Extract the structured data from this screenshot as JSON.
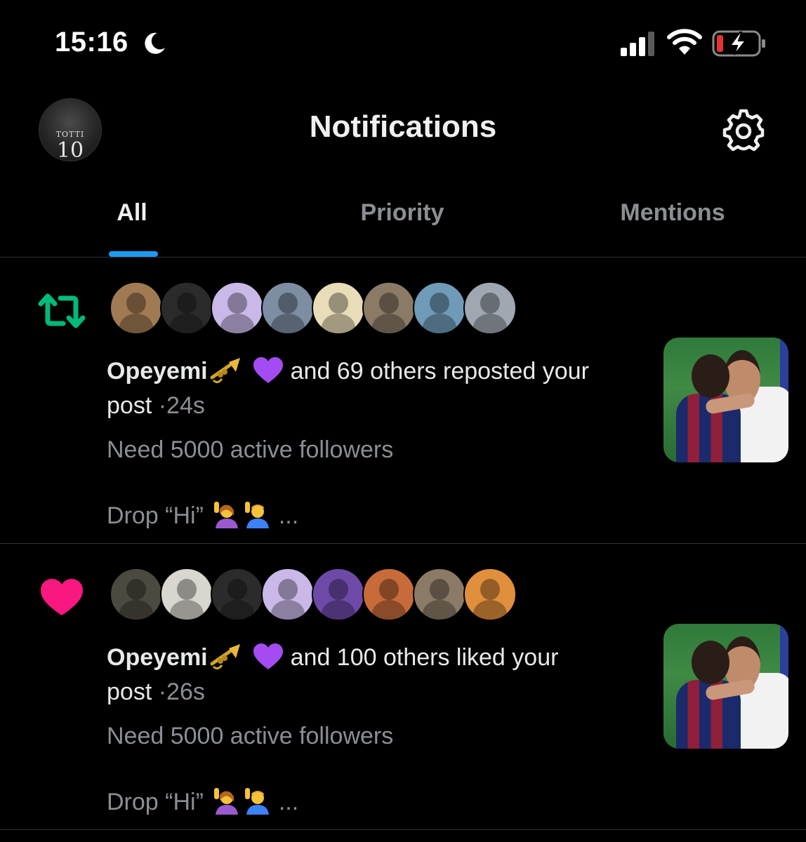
{
  "status_bar": {
    "time": "15:16",
    "icons": [
      "moon-icon",
      "signal-icon",
      "wifi-icon",
      "battery-charging-icon"
    ],
    "battery_color": "#e5342f"
  },
  "header": {
    "avatar": {
      "name": "TOTTI",
      "number": "10"
    },
    "title": "Notifications",
    "settings_icon": "gear-icon"
  },
  "tabs": [
    {
      "label": "All",
      "active": true
    },
    {
      "label": "Priority",
      "active": false
    },
    {
      "label": "Mentions",
      "active": false
    }
  ],
  "colors": {
    "accent": "#1d9bf0",
    "repost": "#00ba7c",
    "like": "#f91880",
    "muted": "#8b8f94"
  },
  "notifications": [
    {
      "type": "repost",
      "icon": "repost-icon",
      "actor": "Opeyemi",
      "actor_emojis": [
        "trumpet-icon",
        "purple-heart-icon"
      ],
      "action": "and 69 others reposted your",
      "action_end": "post",
      "separator": "·",
      "time": "24s",
      "preview_line1": "Need 5000 active followers",
      "preview_line2_prefix": "Drop “Hi”",
      "preview_line2_suffix": "...",
      "avatar_colors": [
        "#a07a52",
        "#2b2b2b",
        "#c9b8e8",
        "#7d8ea3",
        "#e9dcb8",
        "#8a7a66",
        "#6f9bb8",
        "#9fa8b0"
      ]
    },
    {
      "type": "like",
      "icon": "heart-icon",
      "actor": "Opeyemi",
      "actor_emojis": [
        "trumpet-icon",
        "purple-heart-icon"
      ],
      "action": "and 100 others liked your",
      "action_end": "post",
      "separator": "·",
      "time": "26s",
      "preview_line1": "Need 5000 active followers",
      "preview_line2_prefix": "Drop “Hi”",
      "preview_line2_suffix": "...",
      "avatar_colors": [
        "#4c4a40",
        "#d8d6cf",
        "#2b2b2b",
        "#c9b8e8",
        "#6e4aa8",
        "#c86b3a",
        "#8a7a66",
        "#e08f3c"
      ]
    }
  ]
}
